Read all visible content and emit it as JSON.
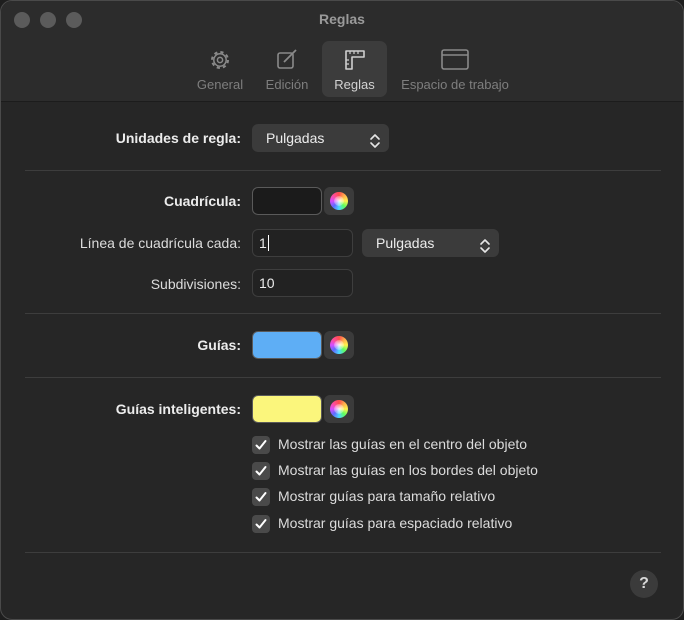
{
  "window": {
    "title": "Reglas"
  },
  "tabs": [
    {
      "label": "General",
      "icon": "gear-icon"
    },
    {
      "label": "Edición",
      "icon": "edit-icon"
    },
    {
      "label": "Reglas",
      "icon": "ruler-icon",
      "active": true
    },
    {
      "label": "Espacio de trabajo",
      "icon": "window-icon"
    }
  ],
  "units": {
    "label": "Unidades de regla:",
    "value": "Pulgadas"
  },
  "grid": {
    "label": "Cuadrícula:",
    "color": "#1b1b1b",
    "spacing_label": "Línea de cuadrícula cada:",
    "spacing_value": "1",
    "spacing_unit": "Pulgadas",
    "subdivisions_label": "Subdivisiones:",
    "subdivisions_value": "10"
  },
  "guides": {
    "label": "Guías:",
    "color": "#5eaef5"
  },
  "smart_guides": {
    "label": "Guías inteligentes:",
    "color": "#fbf67c",
    "options": [
      {
        "label": "Mostrar las guías en el centro del objeto",
        "checked": true
      },
      {
        "label": "Mostrar las guías en los bordes del objeto",
        "checked": true
      },
      {
        "label": "Mostrar guías para tamaño relativo",
        "checked": true
      },
      {
        "label": "Mostrar guías para espaciado relativo",
        "checked": true
      }
    ]
  },
  "help": {
    "label": "?"
  }
}
